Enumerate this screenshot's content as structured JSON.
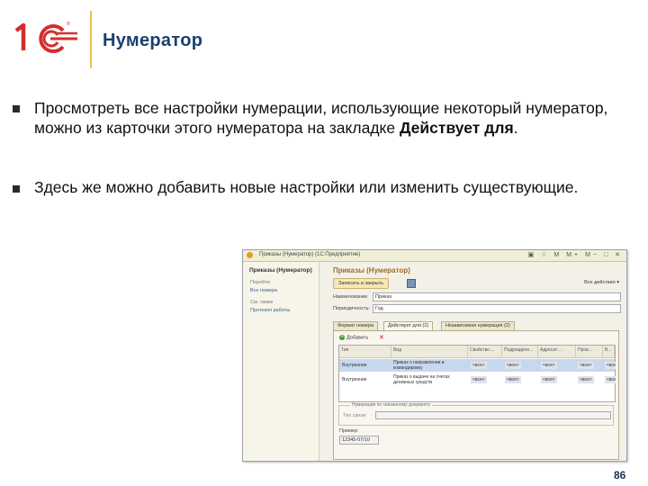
{
  "slide": {
    "title": "Нумератор",
    "bullets": [
      {
        "text_before": "Просмотреть все настройки нумерации, использующие некоторый нумератор, можно из карточки этого нумератора на закладке ",
        "bold": "Действует для",
        "text_after": "."
      },
      {
        "text_before": "Здесь же можно добавить новые настройки или изменить существующие.",
        "bold": "",
        "text_after": ""
      }
    ],
    "page_number": "86",
    "colors": {
      "title": "#1b3f6f",
      "logo": "#d42d2d",
      "separator": "#f0c050"
    }
  },
  "screenshot": {
    "window_title": "Приказы (Нумератор) (1С:Предприятие)",
    "nav": {
      "title": "Приказы (Нумератор)",
      "group_go": "Перейти",
      "items_go": [
        "Все номера"
      ],
      "group_see": "См. также",
      "items_see": [
        "Протокол работы"
      ]
    },
    "form": {
      "title": "Приказы (Нумератор)",
      "save_close": "Записать и закрыть",
      "all_actions": "Все действия ▾",
      "name_label": "Наименование:",
      "name_value": "Приказ",
      "period_label": "Периодичность:",
      "period_value": "Год",
      "tabs": [
        "Формат номера",
        "Действует для (2)",
        "Независимая нумерация (2)"
      ],
      "add_label": "Добавить",
      "columns": [
        "Тип",
        "Вид",
        "Свойство ...",
        "Подразделе...",
        "Адресат ...",
        "Пров...",
        "В..."
      ],
      "rows": [
        {
          "type": "Внутренние",
          "kind": "Приказ о направлении в командировку",
          "c1": "<все>",
          "c2": "<все>",
          "c3": "<все>",
          "c4": "<все>",
          "c5": "<все>"
        },
        {
          "type": "Внутренние",
          "kind": "Приказ о выдаче на счетах денежных средств",
          "c1": "<все>",
          "c2": "<все>",
          "c3": "<все>",
          "c4": "<все>",
          "c5": "<все>"
        }
      ],
      "group_label": "Нумерация по связанному документу",
      "type_label": "Тип связи:",
      "sample_label": "Пример:",
      "sample_value": "12345-07/10"
    }
  }
}
